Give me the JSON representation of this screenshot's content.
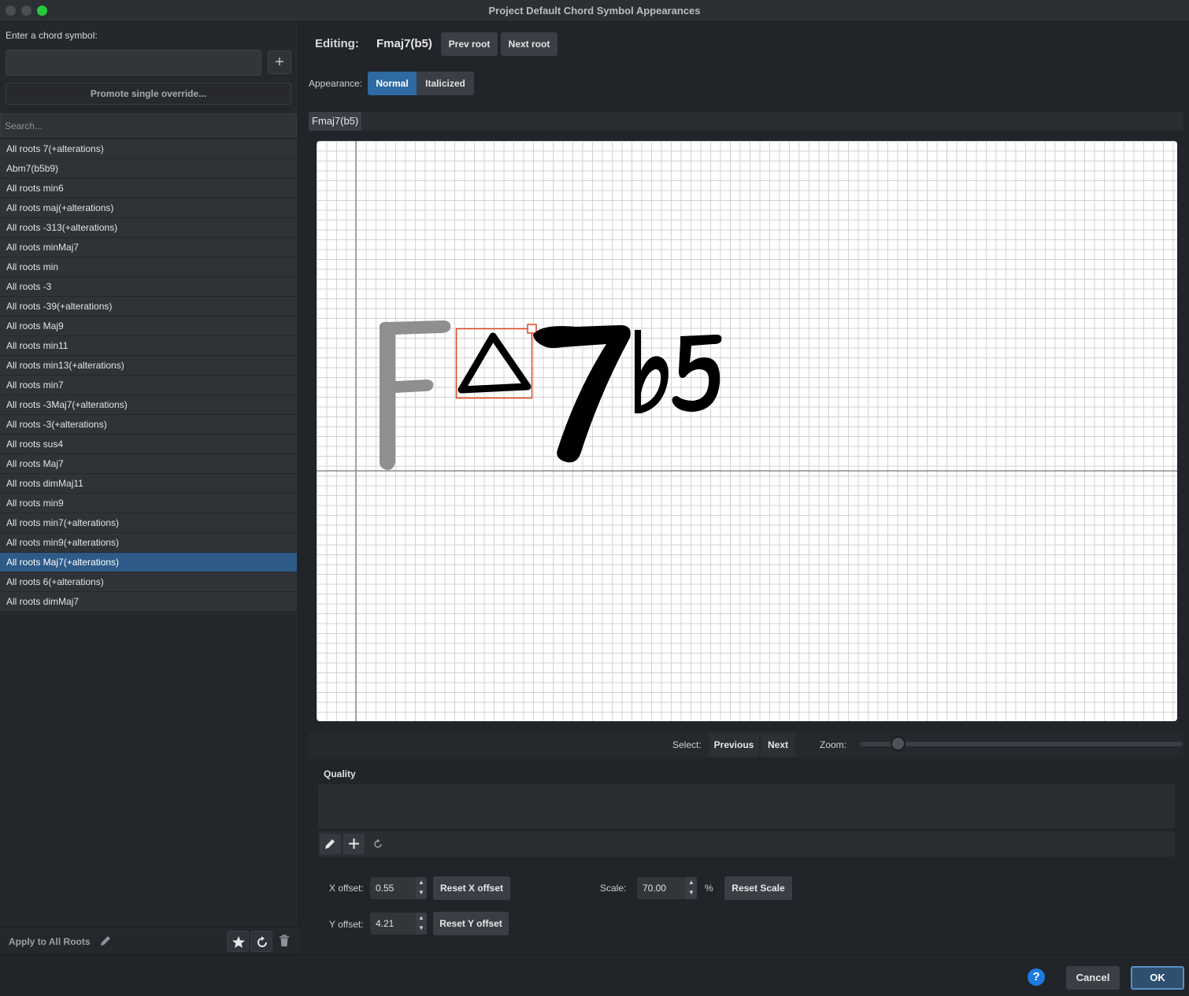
{
  "window": {
    "title": "Project Default Chord Symbol Appearances"
  },
  "left": {
    "enter_label": "Enter a chord symbol:",
    "chord_input_value": "",
    "add_label": "+",
    "promote_label": "Promote single override...",
    "search_placeholder": "Search...",
    "items": [
      "All roots 7(+alterations)",
      "Abm7(b5b9)",
      "All roots min6",
      "All roots maj(+alterations)",
      "All roots -313(+alterations)",
      "All roots minMaj7",
      "All roots min",
      "All roots -3",
      "All roots -39(+alterations)",
      "All roots Maj9",
      "All roots min11",
      "All roots min13(+alterations)",
      "All roots min7",
      "All roots -3Maj7(+alterations)",
      "All roots -3(+alterations)",
      "All roots sus4",
      "All roots Maj7",
      "All roots dimMaj11",
      "All roots min9",
      "All roots min7(+alterations)",
      "All roots min9(+alterations)",
      "All roots Maj7(+alterations)",
      "All roots 6(+alterations)",
      "All roots dimMaj7"
    ],
    "selected_item": "All roots Maj7(+alterations)",
    "apply_label": "Apply to All Roots"
  },
  "editor": {
    "editing_label": "Editing:",
    "editing_value": "Fmaj7(b5)",
    "prev_root": "Prev root",
    "next_root": "Next root",
    "appearance_label": "Appearance:",
    "appearance_options": [
      "Normal",
      "Italicized"
    ],
    "appearance_selected": "Normal",
    "tab_label": "Fmaj7(b5)",
    "glyphs": {
      "root": "F",
      "quality": "△",
      "extension": "7",
      "alteration": "b5"
    },
    "select_label": "Select:",
    "previous_label": "Previous",
    "next_label": "Next",
    "zoom_label": "Zoom:",
    "zoom_level": 0.12,
    "section_label": "Quality",
    "x_offset_label": "X offset:",
    "x_offset_value": "0.55",
    "reset_x_label": "Reset X offset",
    "y_offset_label": "Y offset:",
    "y_offset_value": "4.21",
    "reset_y_label": "Reset Y offset",
    "scale_label": "Scale:",
    "scale_value": "70.00",
    "scale_unit": "%",
    "reset_scale_label": "Reset Scale"
  },
  "footer": {
    "help": "?",
    "cancel": "Cancel",
    "ok": "OK"
  },
  "colors": {
    "accent": "#2e6aa3",
    "selection": "#2e5a87",
    "selected_outline": "#e0461e"
  }
}
